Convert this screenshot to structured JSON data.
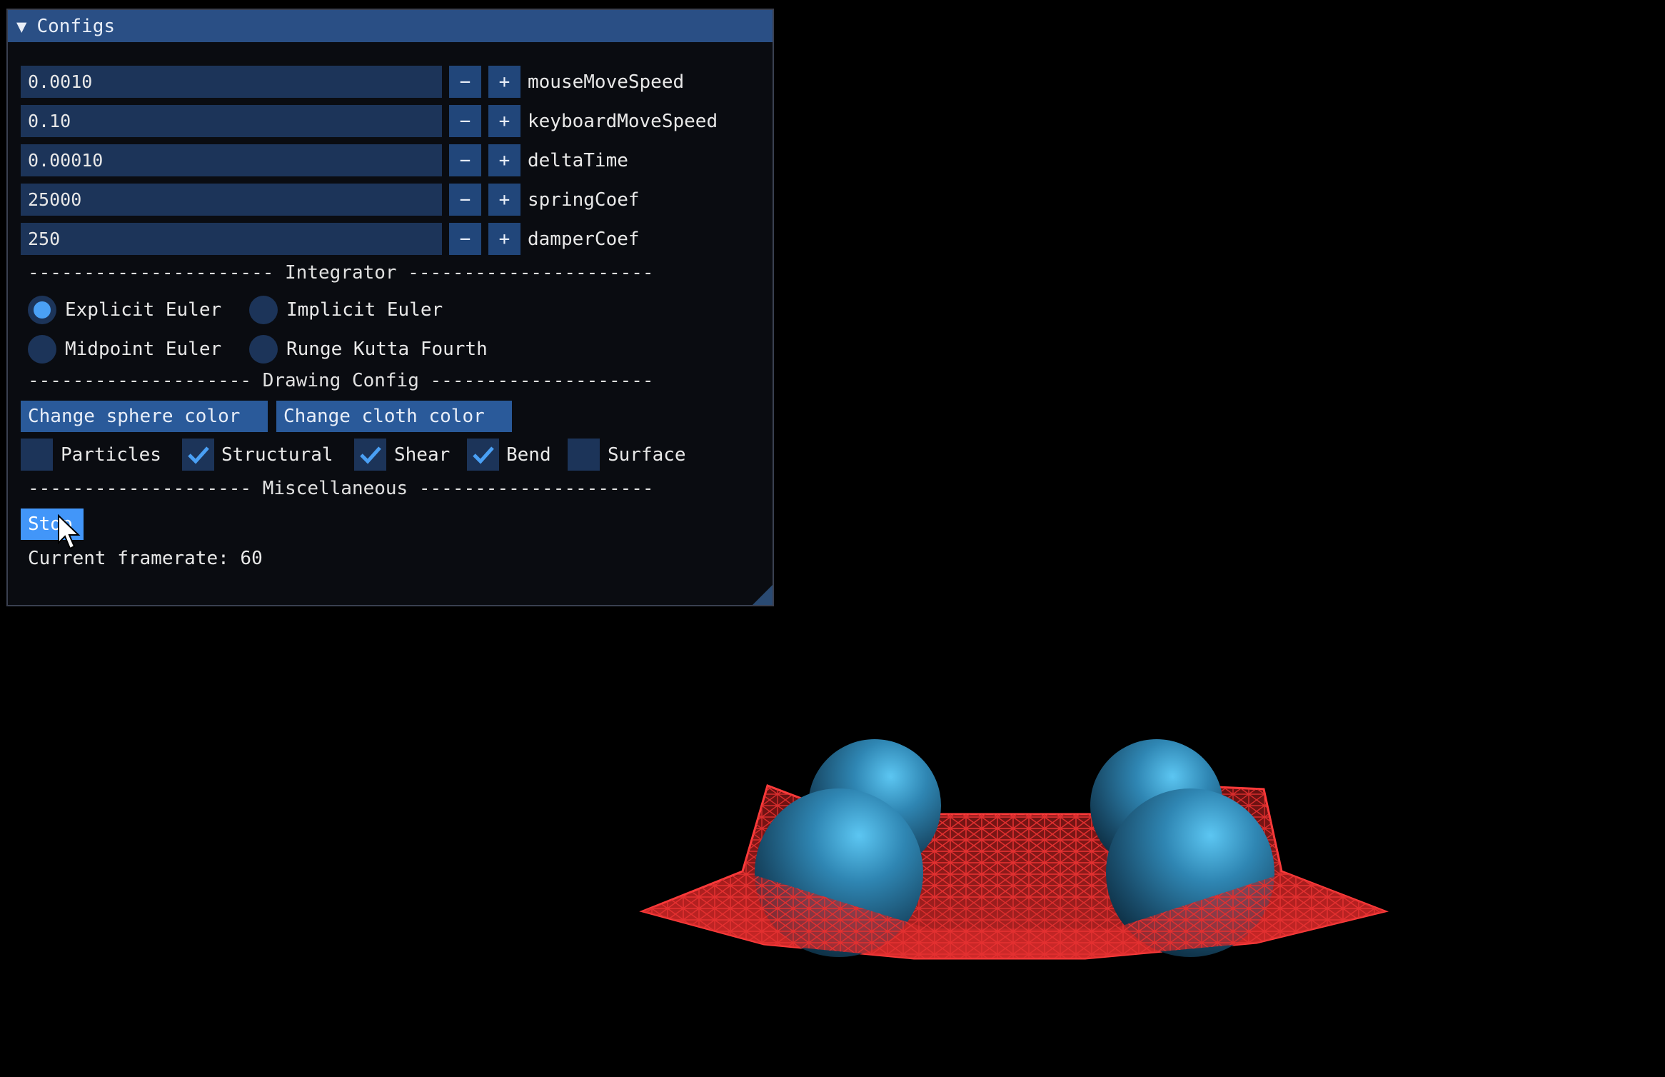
{
  "window": {
    "title": "Configs",
    "collapse_icon": "triangle-down-icon"
  },
  "params": [
    {
      "value": "0.0010",
      "label": "mouseMoveSpeed"
    },
    {
      "value": "0.10",
      "label": "keyboardMoveSpeed"
    },
    {
      "value": "0.00010",
      "label": "deltaTime"
    },
    {
      "value": "25000",
      "label": "springCoef"
    },
    {
      "value": "250",
      "label": "damperCoef"
    }
  ],
  "stepper": {
    "minus": "−",
    "plus": "+"
  },
  "sections": {
    "integrator": "---------------------- Integrator ----------------------",
    "drawing": "-------------------- Drawing Config --------------------",
    "misc": "-------------------- Miscellaneous ---------------------"
  },
  "integrators": [
    {
      "label": "Explicit Euler",
      "selected": true
    },
    {
      "label": "Implicit Euler",
      "selected": false
    },
    {
      "label": "Midpoint Euler",
      "selected": false
    },
    {
      "label": "Runge Kutta Fourth",
      "selected": false
    }
  ],
  "drawing_buttons": {
    "sphere": "Change sphere color",
    "cloth": "Change cloth color"
  },
  "checkboxes": [
    {
      "label": "Particles",
      "checked": false
    },
    {
      "label": "Structural",
      "checked": true
    },
    {
      "label": "Shear",
      "checked": true
    },
    {
      "label": "Bend",
      "checked": true
    },
    {
      "label": "Surface",
      "checked": false
    }
  ],
  "misc": {
    "stop_label": "Stop",
    "framerate_text": "Current framerate: 60"
  },
  "colors": {
    "title_bar": "#2a4f85",
    "field_bg": "#1c3459",
    "button_bg": "#21467a",
    "accent": "#4296f9",
    "check_mark": "#4aa0f5",
    "cloth": "#d42a2a",
    "sphere": "#2f7ea8"
  }
}
